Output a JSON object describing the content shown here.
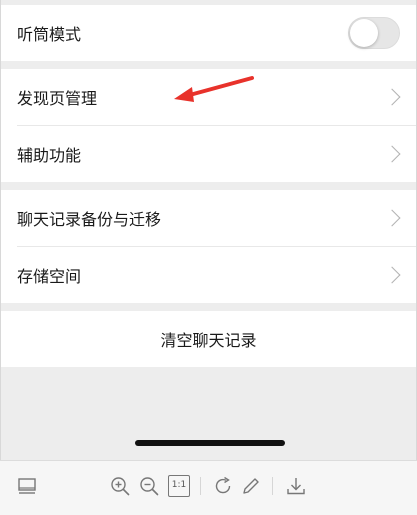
{
  "settings": {
    "earpiece_mode": {
      "label": "听筒模式",
      "enabled": false
    },
    "discover_manage": {
      "label": "发现页管理"
    },
    "accessibility": {
      "label": "辅助功能"
    },
    "chat_backup": {
      "label": "聊天记录备份与迁移"
    },
    "storage": {
      "label": "存储空间"
    },
    "clear_history": {
      "label": "清空聊天记录"
    }
  },
  "toolbar": {
    "icons": [
      "sidebar-icon",
      "zoom-in-icon",
      "zoom-out-icon",
      "actual-size-icon",
      "rotate-icon",
      "pencil-icon",
      "download-icon"
    ],
    "actual_size_label": "1:1"
  },
  "colors": {
    "background": "#ededed",
    "row": "#ffffff",
    "annotation_arrow": "#e8322b",
    "chevron": "#b2b2b2"
  }
}
